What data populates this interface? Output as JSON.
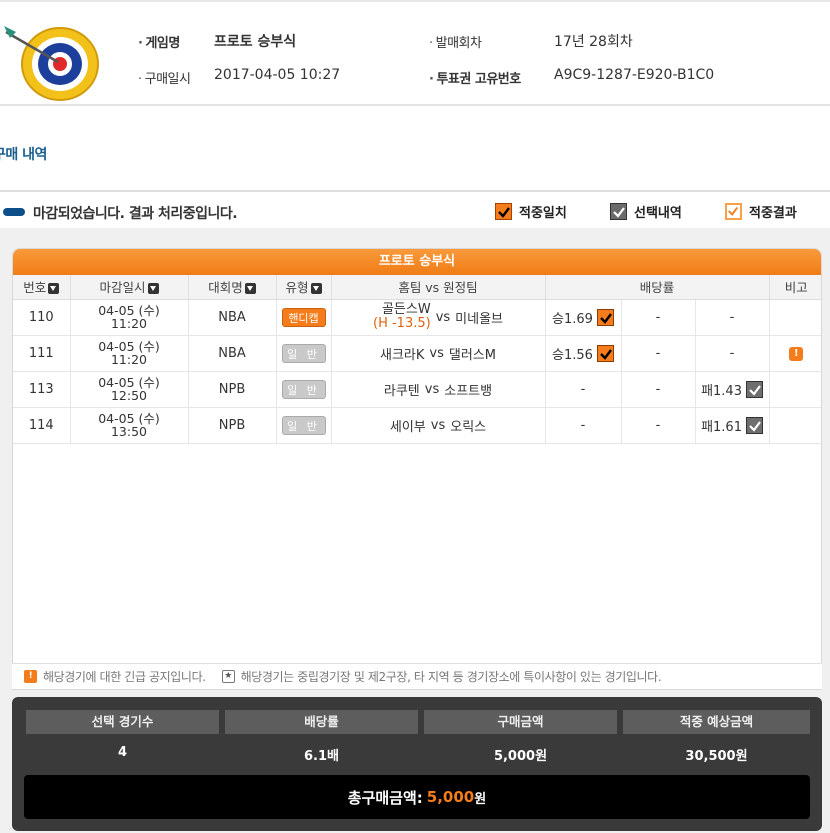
{
  "header": {
    "game_label": "게임명",
    "game_value": "프로토 승부식",
    "purchase_label": "구매일시",
    "purchase_value": "2017-04-05 10:27",
    "round_label": "발매회차",
    "round_value": "17년 28회차",
    "ticket_label": "투표권 고유번호",
    "ticket_value": "A9C9-1287-E920-B1C0"
  },
  "section_title": "구매 내역",
  "status": {
    "message": "마감되었습니다. 결과 처리중입니다.",
    "legend": [
      "적중일치",
      "선택내역",
      "적중결과"
    ]
  },
  "table": {
    "title": "프로토 승부식",
    "headers": [
      "번호",
      "마감일시",
      "대회명",
      "유형",
      "홈팀 vs 원정팀",
      "배당률",
      "비고"
    ],
    "rows": [
      {
        "no": "110",
        "date": "04-05 (수)",
        "time": "11:20",
        "league": "NBA",
        "type": "핸디캡",
        "home": "골든스W",
        "handicap": "(H -13.5)",
        "vs": "vs",
        "away": "미네올브",
        "odd1": "승1.69",
        "odd2": "-",
        "odd3": "-"
      },
      {
        "no": "111",
        "date": "04-05 (수)",
        "time": "11:20",
        "league": "NBA",
        "type": "일 반",
        "home": "새크라K",
        "vs": "vs",
        "away": "댈러스M",
        "odd1": "승1.56",
        "odd2": "-",
        "odd3": "-",
        "note_icon": "!"
      },
      {
        "no": "113",
        "date": "04-05 (수)",
        "time": "12:50",
        "league": "NPB",
        "type": "일 반",
        "home": "라쿠텐",
        "vs": "vs",
        "away": "소프트뱅",
        "odd1": "-",
        "odd2": "-",
        "odd3": "패1.43"
      },
      {
        "no": "114",
        "date": "04-05 (수)",
        "time": "13:50",
        "league": "NPB",
        "type": "일 반",
        "home": "세이부",
        "vs": "vs",
        "away": "오릭스",
        "odd1": "-",
        "odd2": "-",
        "odd3": "패1.61"
      }
    ]
  },
  "notes": {
    "note1": "해당경기에 대한 긴급 공지입니다.",
    "note2": "해당경기는 중립경기장 및 제2구장, 타 지역 등 경기장소에 특이사항이 있는 경기입니다."
  },
  "summary": {
    "headers": [
      "선택 경기수",
      "배당률",
      "구매금액",
      "적중 예상금액"
    ],
    "values": [
      "4",
      "6.1배",
      "5,000원",
      "30,500원"
    ],
    "total_label": "총구매금액:",
    "total_amount": "5,000",
    "total_unit": "원"
  },
  "colors": {
    "accent": "#f47c1a",
    "navy": "#0d4f8a",
    "dark": "#3a3a3a"
  }
}
